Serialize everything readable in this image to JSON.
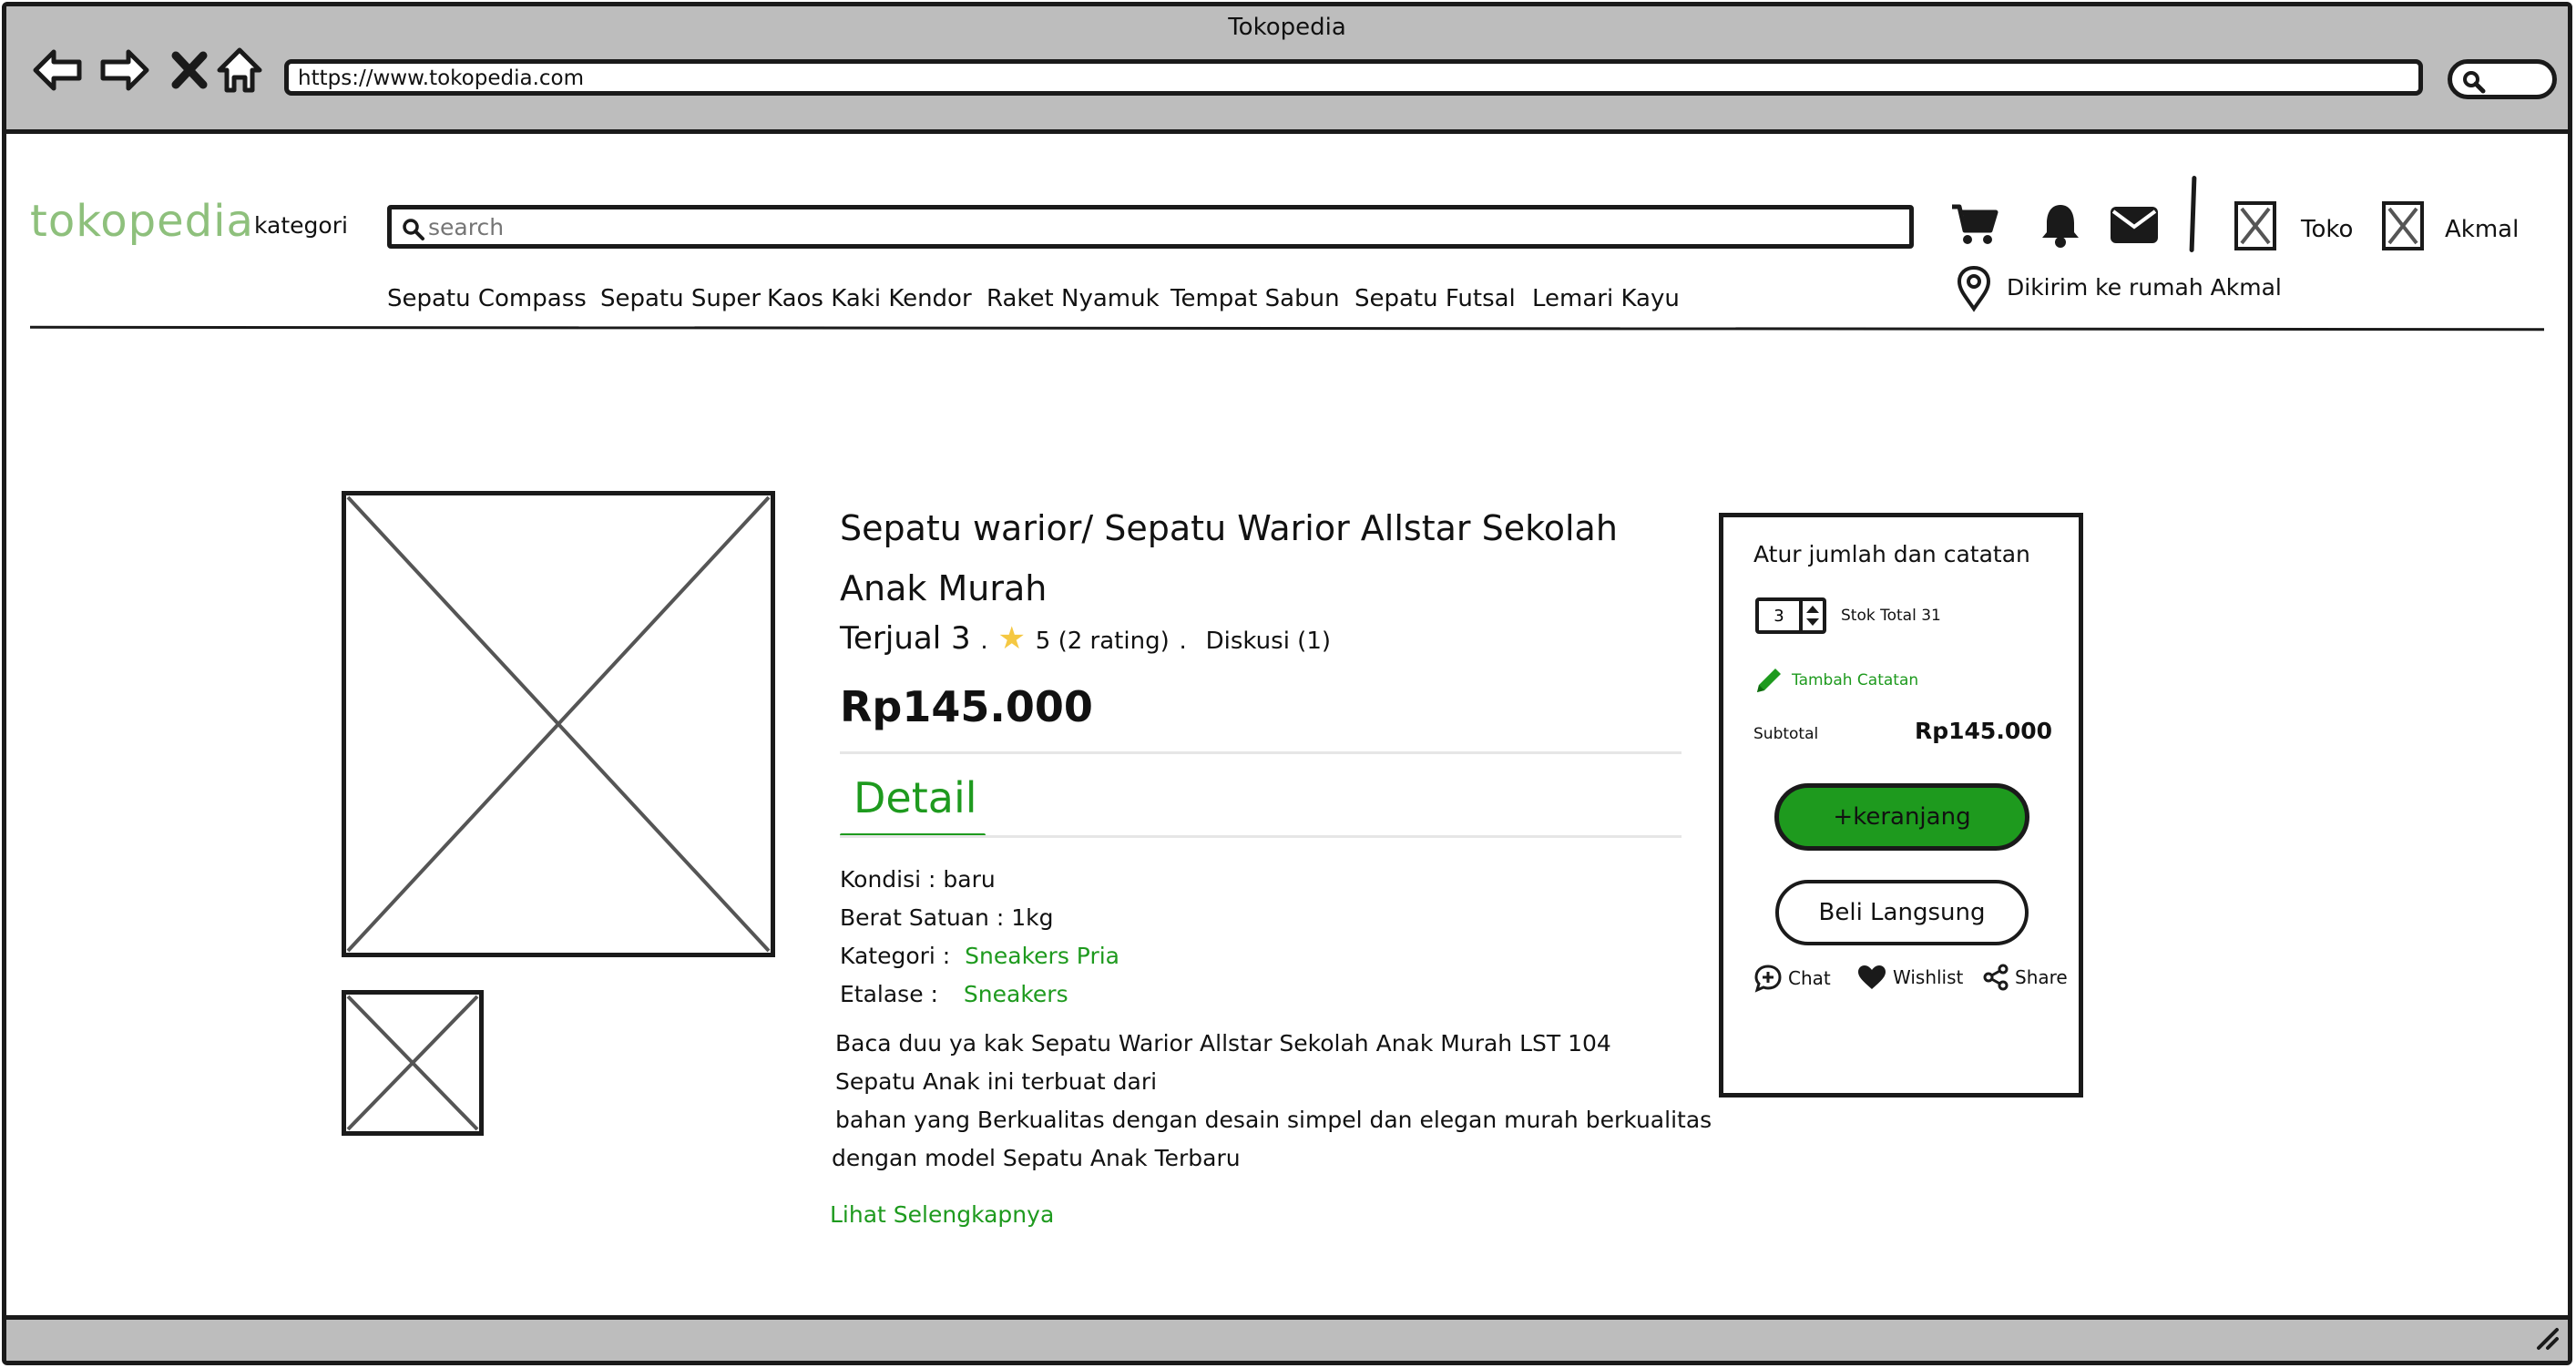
{
  "window": {
    "title": "Tokopedia"
  },
  "browser": {
    "url": "https://www.tokopedia.com"
  },
  "header": {
    "logo": "tokopedia",
    "category": "kategori",
    "search_placeholder": "search",
    "store_label": "Toko",
    "user_label": "Akmal",
    "shipping_text": "Dikirim ke rumah Akmal",
    "tags": [
      "Sepatu Compass",
      "Sepatu Super",
      "Kaos Kaki Kendor",
      "Raket Nyamuk",
      "Tempat Sabun",
      "Sepatu Futsal",
      "Lemari Kayu"
    ]
  },
  "product": {
    "title": "Sepatu warior/ Sepatu Warior Allstar Sekolah Anak Murah",
    "sold": "Terjual 3",
    "sep1": ".",
    "rating": "5 (2 rating)",
    "sep2": ".",
    "discussion": "Diskusi (1)",
    "price": "Rp145.000",
    "detail_tab": "Detail",
    "specs": {
      "kondisi": "Kondisi : baru",
      "berat": "Berat Satuan : 1kg",
      "kategori_label": "Kategori :",
      "kategori_value": "Sneakers Pria",
      "etalase_label": "Etalase :",
      "etalase_value": "Sneakers"
    },
    "description": [
      "Baca duu ya kak Sepatu Warior Allstar Sekolah Anak Murah LST 104",
      "Sepatu Anak ini terbuat dari",
      "bahan yang Berkualitas dengan desain simpel dan elegan murah berkualitas",
      "dengan model Sepatu Anak Terbaru"
    ],
    "see_more": "Lihat Selengkapnya"
  },
  "purchase": {
    "title": "Atur jumlah dan catatan",
    "quantity": "3",
    "stock": "Stok Total 31",
    "add_note": "Tambah Catatan",
    "subtotal_label": "Subtotal",
    "subtotal_value": "Rp145.000",
    "cart_button": "+keranjang",
    "buy_button": "Beli Langsung",
    "chat": "Chat",
    "wishlist": "Wishlist",
    "share": "Share"
  },
  "colors": {
    "brand_green": "#1e9a1e",
    "logo_green": "#8ec07c",
    "chrome_gray": "#bdbdbd",
    "star": "#f5c842"
  }
}
